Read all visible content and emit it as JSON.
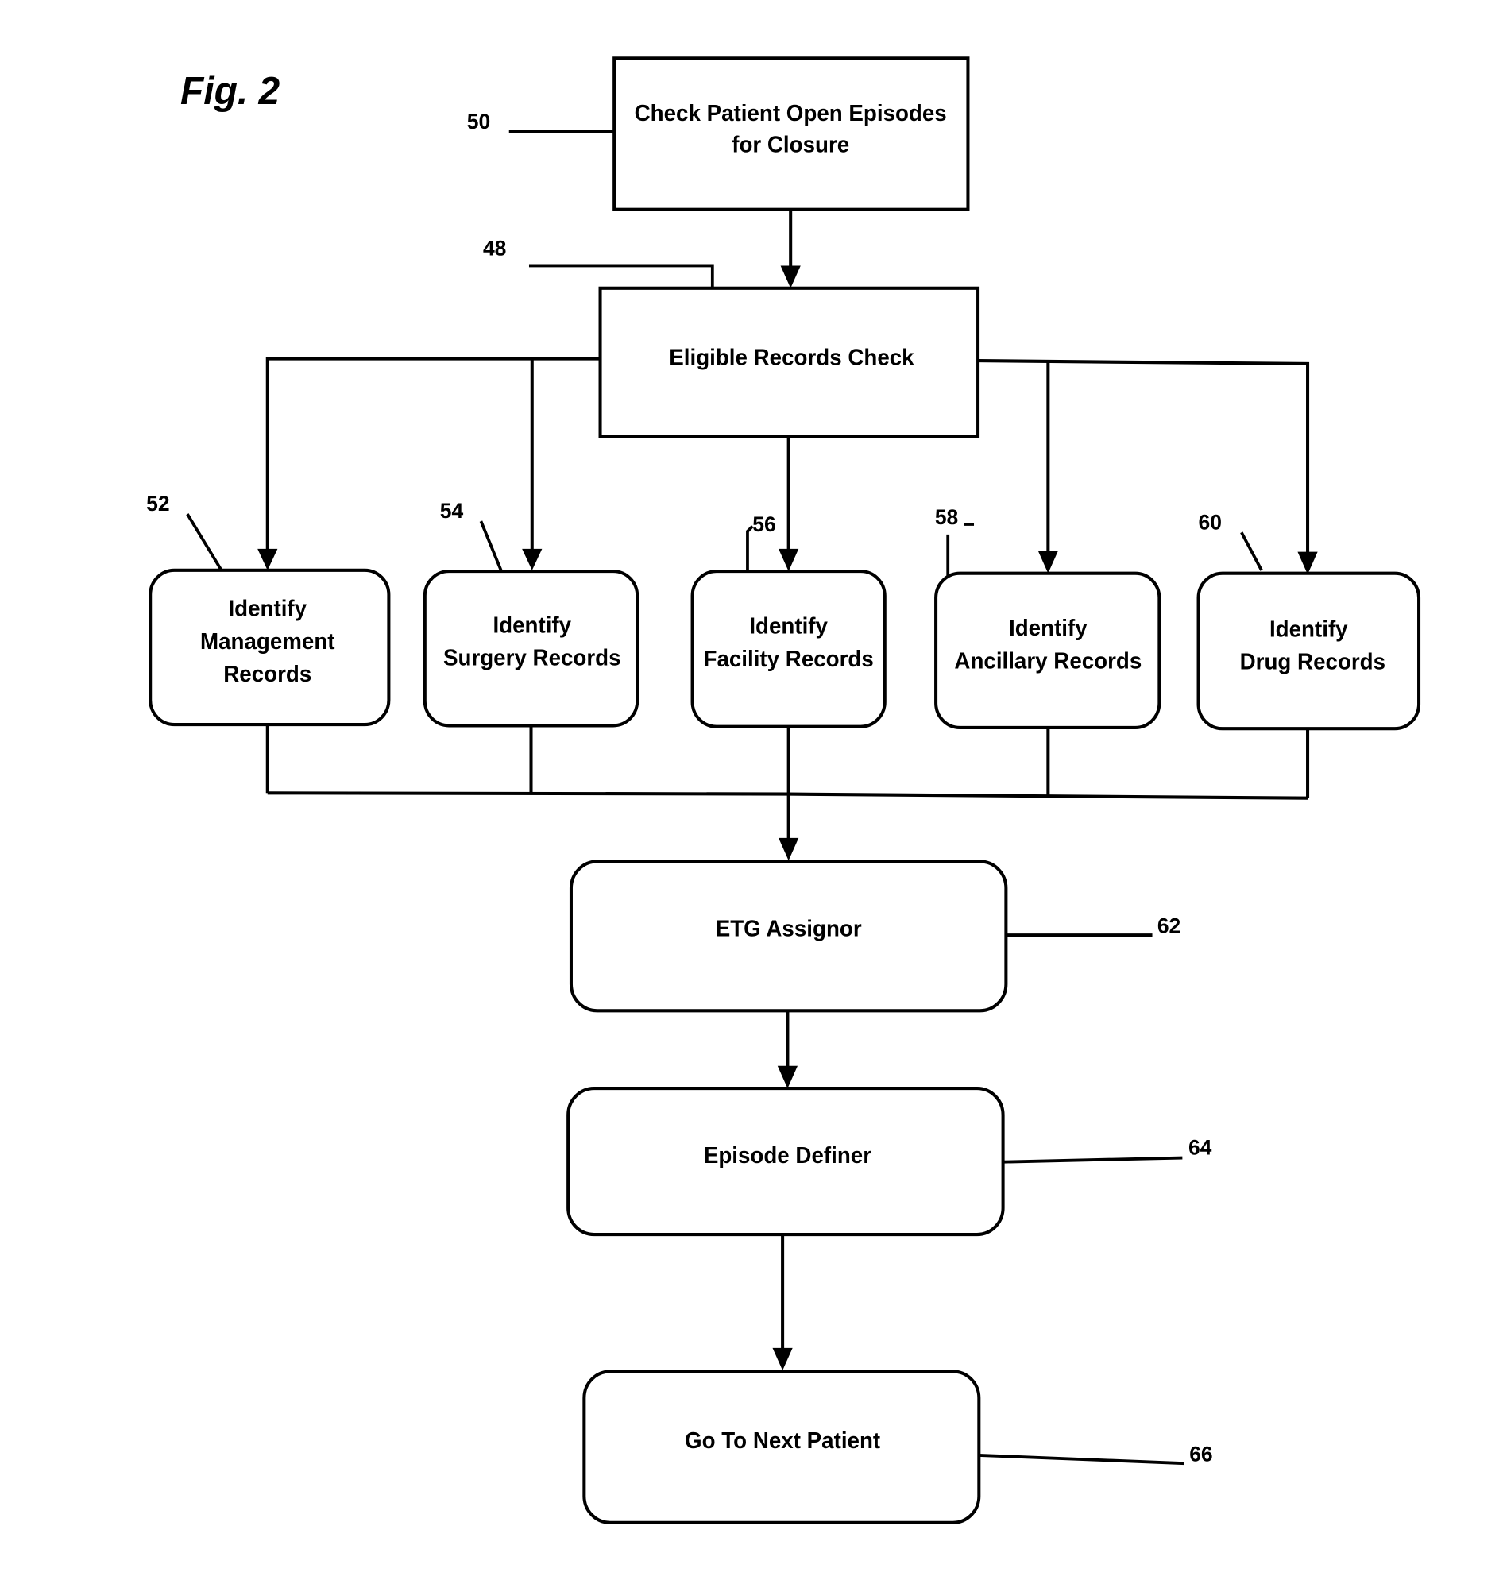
{
  "figure": {
    "title": "Fig. 2",
    "nodes": [
      {
        "id": "check-open-episodes",
        "ref": "50",
        "lines": [
          "Check Patient Open Episodes",
          "for Closure"
        ],
        "shape": "rectangle"
      },
      {
        "id": "eligible-records-check",
        "ref": "48",
        "lines": [
          "Eligible Records Check"
        ],
        "shape": "rectangle"
      },
      {
        "id": "identify-management-records",
        "ref": "52",
        "lines": [
          "Identify",
          "Management",
          "Records"
        ],
        "shape": "rounded"
      },
      {
        "id": "identify-surgery-records",
        "ref": "54",
        "lines": [
          "Identify",
          "Surgery Records"
        ],
        "shape": "rounded"
      },
      {
        "id": "identify-facility-records",
        "ref": "56",
        "lines": [
          "Identify",
          "Facility Records"
        ],
        "shape": "rounded"
      },
      {
        "id": "identify-ancillary-records",
        "ref": "58",
        "lines": [
          "Identify",
          "Ancillary Records"
        ],
        "shape": "rounded"
      },
      {
        "id": "identify-drug-records",
        "ref": "60",
        "lines": [
          "Identify",
          "Drug Records"
        ],
        "shape": "rounded"
      },
      {
        "id": "etg-assignor",
        "ref": "62",
        "lines": [
          "ETG Assignor"
        ],
        "shape": "rounded"
      },
      {
        "id": "episode-definer",
        "ref": "64",
        "lines": [
          "Episode Definer"
        ],
        "shape": "rounded"
      },
      {
        "id": "go-to-next-patient",
        "ref": "66",
        "lines": [
          "Go To Next Patient"
        ],
        "shape": "rounded"
      }
    ],
    "edges": [
      {
        "from": "check-open-episodes",
        "to": "eligible-records-check"
      },
      {
        "from": "eligible-records-check",
        "to": "identify-management-records"
      },
      {
        "from": "eligible-records-check",
        "to": "identify-surgery-records"
      },
      {
        "from": "eligible-records-check",
        "to": "identify-facility-records"
      },
      {
        "from": "eligible-records-check",
        "to": "identify-ancillary-records"
      },
      {
        "from": "eligible-records-check",
        "to": "identify-drug-records"
      },
      {
        "from": "identify-management-records",
        "to": "etg-assignor"
      },
      {
        "from": "identify-surgery-records",
        "to": "etg-assignor"
      },
      {
        "from": "identify-facility-records",
        "to": "etg-assignor"
      },
      {
        "from": "identify-ancillary-records",
        "to": "etg-assignor"
      },
      {
        "from": "identify-drug-records",
        "to": "etg-assignor"
      },
      {
        "from": "etg-assignor",
        "to": "episode-definer"
      },
      {
        "from": "episode-definer",
        "to": "go-to-next-patient"
      }
    ]
  }
}
